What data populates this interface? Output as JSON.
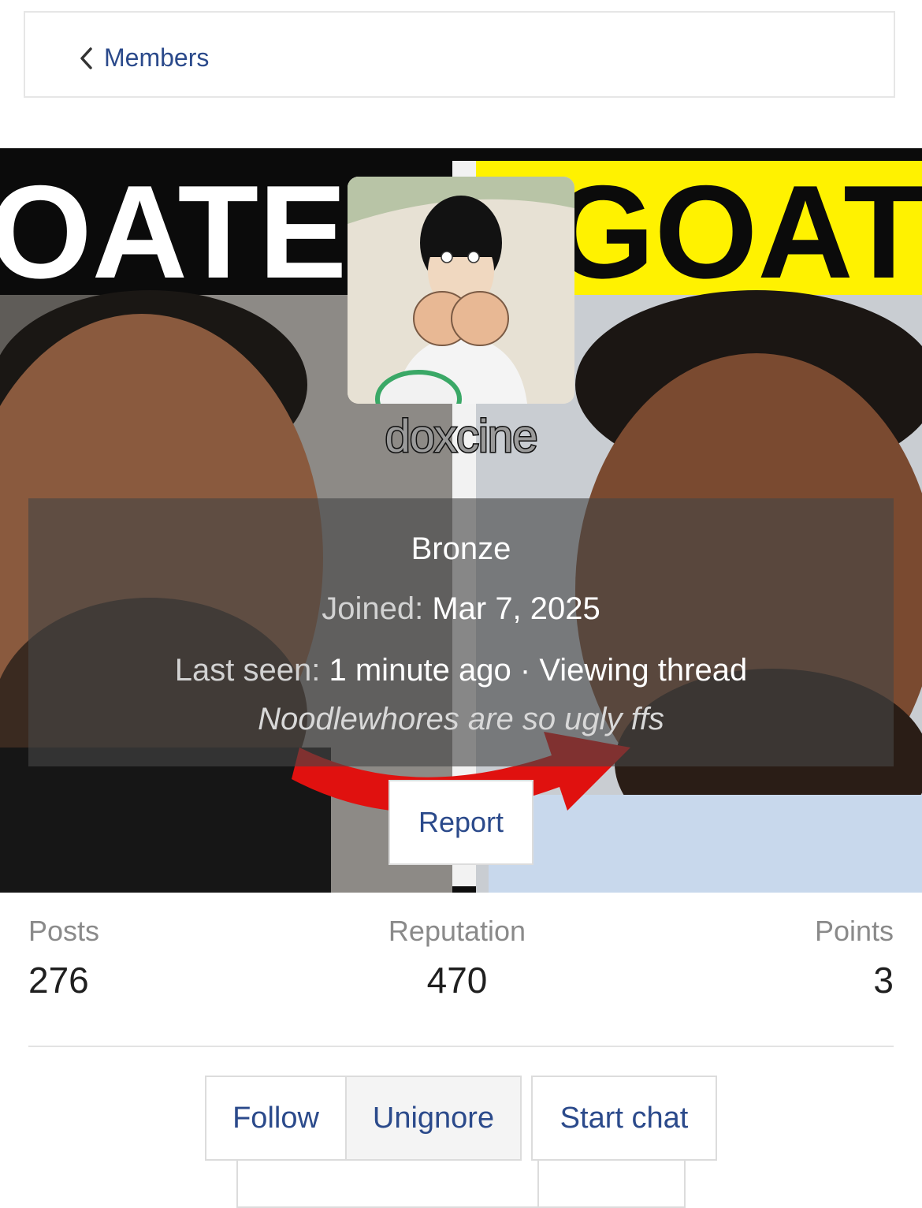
{
  "breadcrumb": {
    "label": "Members"
  },
  "banner": {
    "left_text": "OATE",
    "right_text": "GOAT"
  },
  "profile": {
    "username": "doxcine",
    "rank": "Bronze",
    "joined_label": "Joined:",
    "joined_value": "Mar 7, 2025",
    "last_seen_label": "Last seen:",
    "last_seen_value": "1 minute ago · Viewing thread",
    "status": "Noodlewhores are so ugly ffs"
  },
  "actions": {
    "report": "Report",
    "follow": "Follow",
    "unignore": "Unignore",
    "start_chat": "Start chat"
  },
  "stats": [
    {
      "label": "Posts",
      "value": "276"
    },
    {
      "label": "Reputation",
      "value": "470"
    },
    {
      "label": "Points",
      "value": "3"
    }
  ],
  "colors": {
    "link": "#2b4a8b",
    "banner_yellow": "#fff200",
    "overlay": "#464646"
  }
}
